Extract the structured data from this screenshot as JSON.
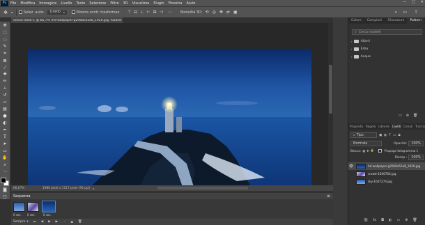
{
  "app": {
    "logo": "Ps"
  },
  "menu": [
    "File",
    "Modifica",
    "Immagine",
    "Livello",
    "Testo",
    "Selezione",
    "Filtro",
    "3D",
    "Visualizza",
    "Plugin",
    "Finestra",
    "Aiuto"
  ],
  "window_controls": [
    "—",
    "□",
    "✕"
  ],
  "options": {
    "auto_select_label": "Selez. auto:",
    "auto_select_value": "Livello",
    "show_transform_label": "Mostra contr. trasformaz.",
    "mode_3d_label": "Modalità 3D:"
  },
  "document": {
    "tab_title": "Senza titolo-1 @ 66,7% (hd-wallpaper-g2068c62a8_1920.jpg, RGB/8) *",
    "zoom": "66,67%",
    "doc_info": "1980 pixel x 1117 pixel (96 ppi)"
  },
  "bottom_panel": {
    "title": "Sequenza",
    "frames": [
      {
        "label": "0 sec."
      },
      {
        "label": "0 sec."
      },
      {
        "label": "0 sec."
      }
    ],
    "loop_option": "Sempre"
  },
  "right_top": {
    "tabs": [
      "Colore",
      "Campioni",
      "Sfumature",
      "Pattern"
    ],
    "active_tab": "Pattern",
    "search_placeholder": "Cerca modelli",
    "folders": [
      "Alberi",
      "Erba",
      "Acqua"
    ]
  },
  "right_bottom": {
    "tabs": [
      "Proprietà",
      "Regola",
      "Librerie",
      "Livelli",
      "Canali",
      "Tracciati"
    ],
    "active_tab": "Livelli",
    "filter_label": "Tipo",
    "blend_mode": "Normale",
    "opacity_label": "Opacità:",
    "opacity_value": "100%",
    "lock_label": "Blocca:",
    "fill_label": "Riemp.:",
    "fill_value": "100%",
    "propagate_label": "Propaga fotogramma 1",
    "layers": [
      {
        "name": "hd-wallpaper-g2068c62a8_1920.jpg",
        "visible": true,
        "selected": true
      },
      {
        "name": "crowd-1056764.jpg",
        "visible": false,
        "selected": false
      },
      {
        "name": "sky-1007274.jpg",
        "visible": false,
        "selected": false
      }
    ]
  },
  "colors": {
    "accent": "#31a8ff",
    "panel": "#323232",
    "bar": "#535353"
  }
}
